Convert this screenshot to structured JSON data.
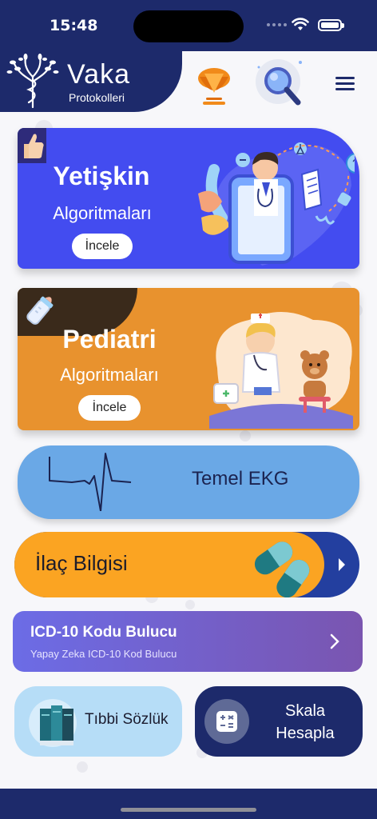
{
  "status": {
    "time": "15:48"
  },
  "header": {
    "app_name": "Vaka",
    "app_subtitle": "Protokolleri"
  },
  "cards": {
    "adult": {
      "title": "Yetişkin",
      "subtitle": "Algoritmaları",
      "button": "İncele"
    },
    "pediatric": {
      "title": "Pediatri",
      "subtitle": "Algoritmaları",
      "button": "İncele"
    },
    "ekg": {
      "label": "Temel EKG"
    },
    "drug": {
      "label": "İlaç Bilgisi"
    },
    "icd": {
      "title": "ICD-10 Kodu Bulucu",
      "subtitle": "Yapay Zeka ICD-10 Kod Bulucu"
    },
    "dictionary": {
      "label": "Tıbbi Sözlük"
    },
    "scale": {
      "label_line1": "Skala",
      "label_line2": "Hesapla"
    }
  },
  "colors": {
    "navy": "#1d2a6b",
    "adult_card": "#434cf0",
    "pediatric_card": "#e8922e",
    "ekg_card": "#6aa8e6",
    "drug_card": "#fba422",
    "dictionary_card": "#b6ddf7"
  },
  "icons": [
    "caduceus-tree-icon",
    "trophy-icon",
    "search-icon",
    "menu-icon",
    "thumbs-up-icon",
    "baby-bottle-icon",
    "ekg-wave-icon",
    "pill-icon",
    "chevron-right-icon",
    "books-icon",
    "calculator-icon"
  ]
}
